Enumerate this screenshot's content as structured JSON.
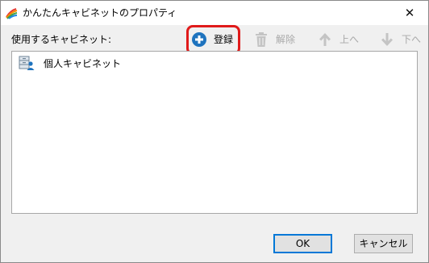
{
  "window": {
    "title": "かんたんキャビネットのプロパティ",
    "close_glyph": "✕"
  },
  "list_label": "使用するキャビネット:",
  "toolbar": {
    "register": {
      "label": "登録",
      "icon": "plus-circle-icon",
      "enabled": true
    },
    "remove": {
      "label": "解除",
      "icon": "trash-icon",
      "enabled": false
    },
    "move_up": {
      "label": "上へ",
      "icon": "arrow-up-icon",
      "enabled": false
    },
    "move_down": {
      "label": "下へ",
      "icon": "arrow-down-icon",
      "enabled": false
    }
  },
  "cabinets": [
    {
      "label": "個人キャビネット",
      "icon": "personal-cabinet-icon"
    }
  ],
  "buttons": {
    "ok": "OK",
    "cancel": "キャンセル"
  },
  "colors": {
    "accent_blue": "#1e73be",
    "highlight_red": "#e01a1a",
    "disabled_gray": "#a9a9a9"
  }
}
